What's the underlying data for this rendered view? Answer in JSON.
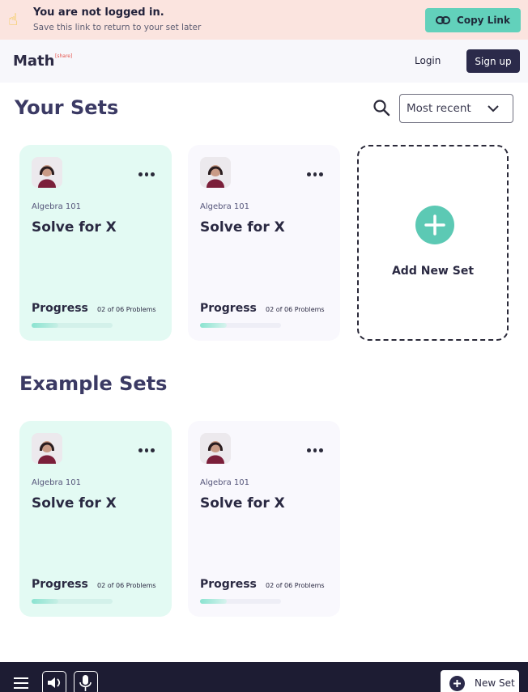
{
  "banner": {
    "title": "You are not logged in.",
    "subtitle": "Save this link to return to your set later",
    "icon": "pointing-hand-icon",
    "copy_label": "Copy Link",
    "copy_icon": "link-icon",
    "accent": "#62d1bb"
  },
  "header": {
    "logo": "Math",
    "logo_sup": "[share]",
    "login_label": "Login",
    "signup_label": "Sign up"
  },
  "your_sets": {
    "heading": "Your Sets",
    "sort": {
      "selected": "Most recent"
    },
    "cards": [
      {
        "subject": "Algebra 101",
        "title": "Solve for X",
        "progress_label": "Progress",
        "progress_text": "02 of 06 Problems",
        "progress": 0.33,
        "active": true
      },
      {
        "subject": "Algebra 101",
        "title": "Solve for X",
        "progress_label": "Progress",
        "progress_text": "02 of 06 Problems",
        "progress": 0.33,
        "active": false
      }
    ],
    "add_label": "Add New Set"
  },
  "example_sets": {
    "heading": "Example Sets",
    "cards": [
      {
        "subject": "Algebra 101",
        "title": "Solve for X",
        "progress_label": "Progress",
        "progress_text": "02 of 06 Problems",
        "progress": 0.33,
        "active": true
      },
      {
        "subject": "Algebra 101",
        "title": "Solve for X",
        "progress_label": "Progress",
        "progress_text": "02 of 06 Problems",
        "progress": 0.33,
        "active": false
      }
    ]
  },
  "footer": {
    "new_set_label": "New Set"
  },
  "colors": {
    "card_active": "#e3faf3",
    "card_plain": "#f9f8fd",
    "dark": "#1d1c33"
  }
}
